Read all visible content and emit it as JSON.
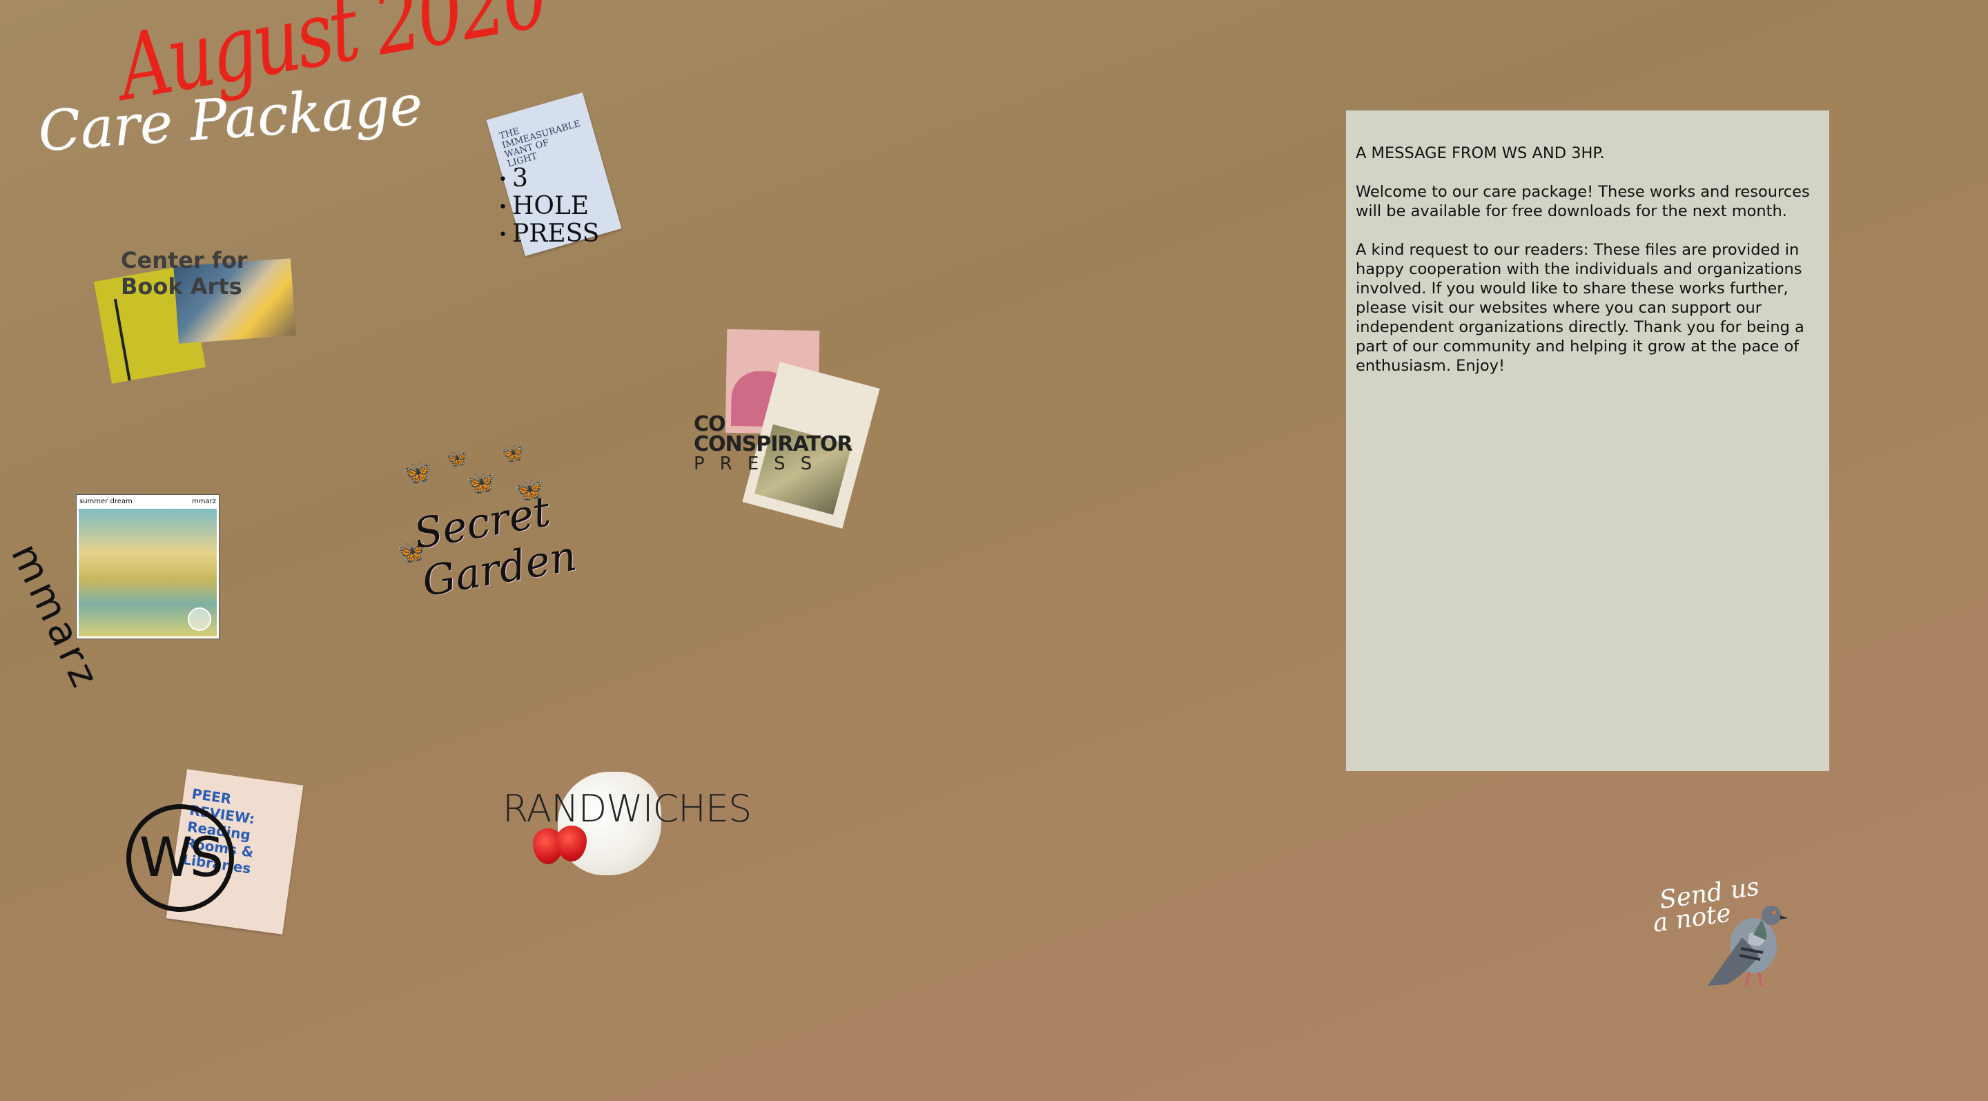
{
  "title": {
    "line1": "August 2020",
    "line2": "Care Package"
  },
  "publishers": {
    "three_hole_press": {
      "card_text": "The Immeasurable Want of Light",
      "logo_lines": [
        "3",
        "HOLE",
        "PRESS"
      ]
    },
    "center_for_book_arts": {
      "lines": [
        "Center for",
        "Book Arts"
      ]
    },
    "mmarz": {
      "logo": "mmarz",
      "card_title": "summer dream",
      "card_brand": "mmarz"
    },
    "secret_garden": {
      "lines": [
        "Secret",
        "Garden"
      ]
    },
    "co_conspirator_press": {
      "lines": [
        "CO",
        "CONSPIRATOR"
      ],
      "press": "PRESS"
    },
    "ws": {
      "logo": "WS",
      "card_text": "PEER REVIEW: Reading Rooms & Libraries"
    },
    "randwiches": {
      "logo": "RANDWICHES"
    }
  },
  "message": {
    "heading": "A MESSAGE FROM WS AND 3HP.",
    "para1": "Welcome to our care package! These works and resources will be available for free downloads for the next month.",
    "para2": "A kind request to our readers: These files are provided in happy cooperation with the individuals and organizations involved. If you would like to share these works further, please visit our websites where you can support our independent organizations directly. Thank you for being a part of our community and helping it grow at the pace of enthusiasm. Enjoy!"
  },
  "contact": {
    "line1": "Send us",
    "line2": "a note",
    "icon": "pigeon-icon"
  },
  "colors": {
    "background": "#a58a63",
    "title_red": "#e8241a",
    "panel": "#d4d4c6"
  }
}
